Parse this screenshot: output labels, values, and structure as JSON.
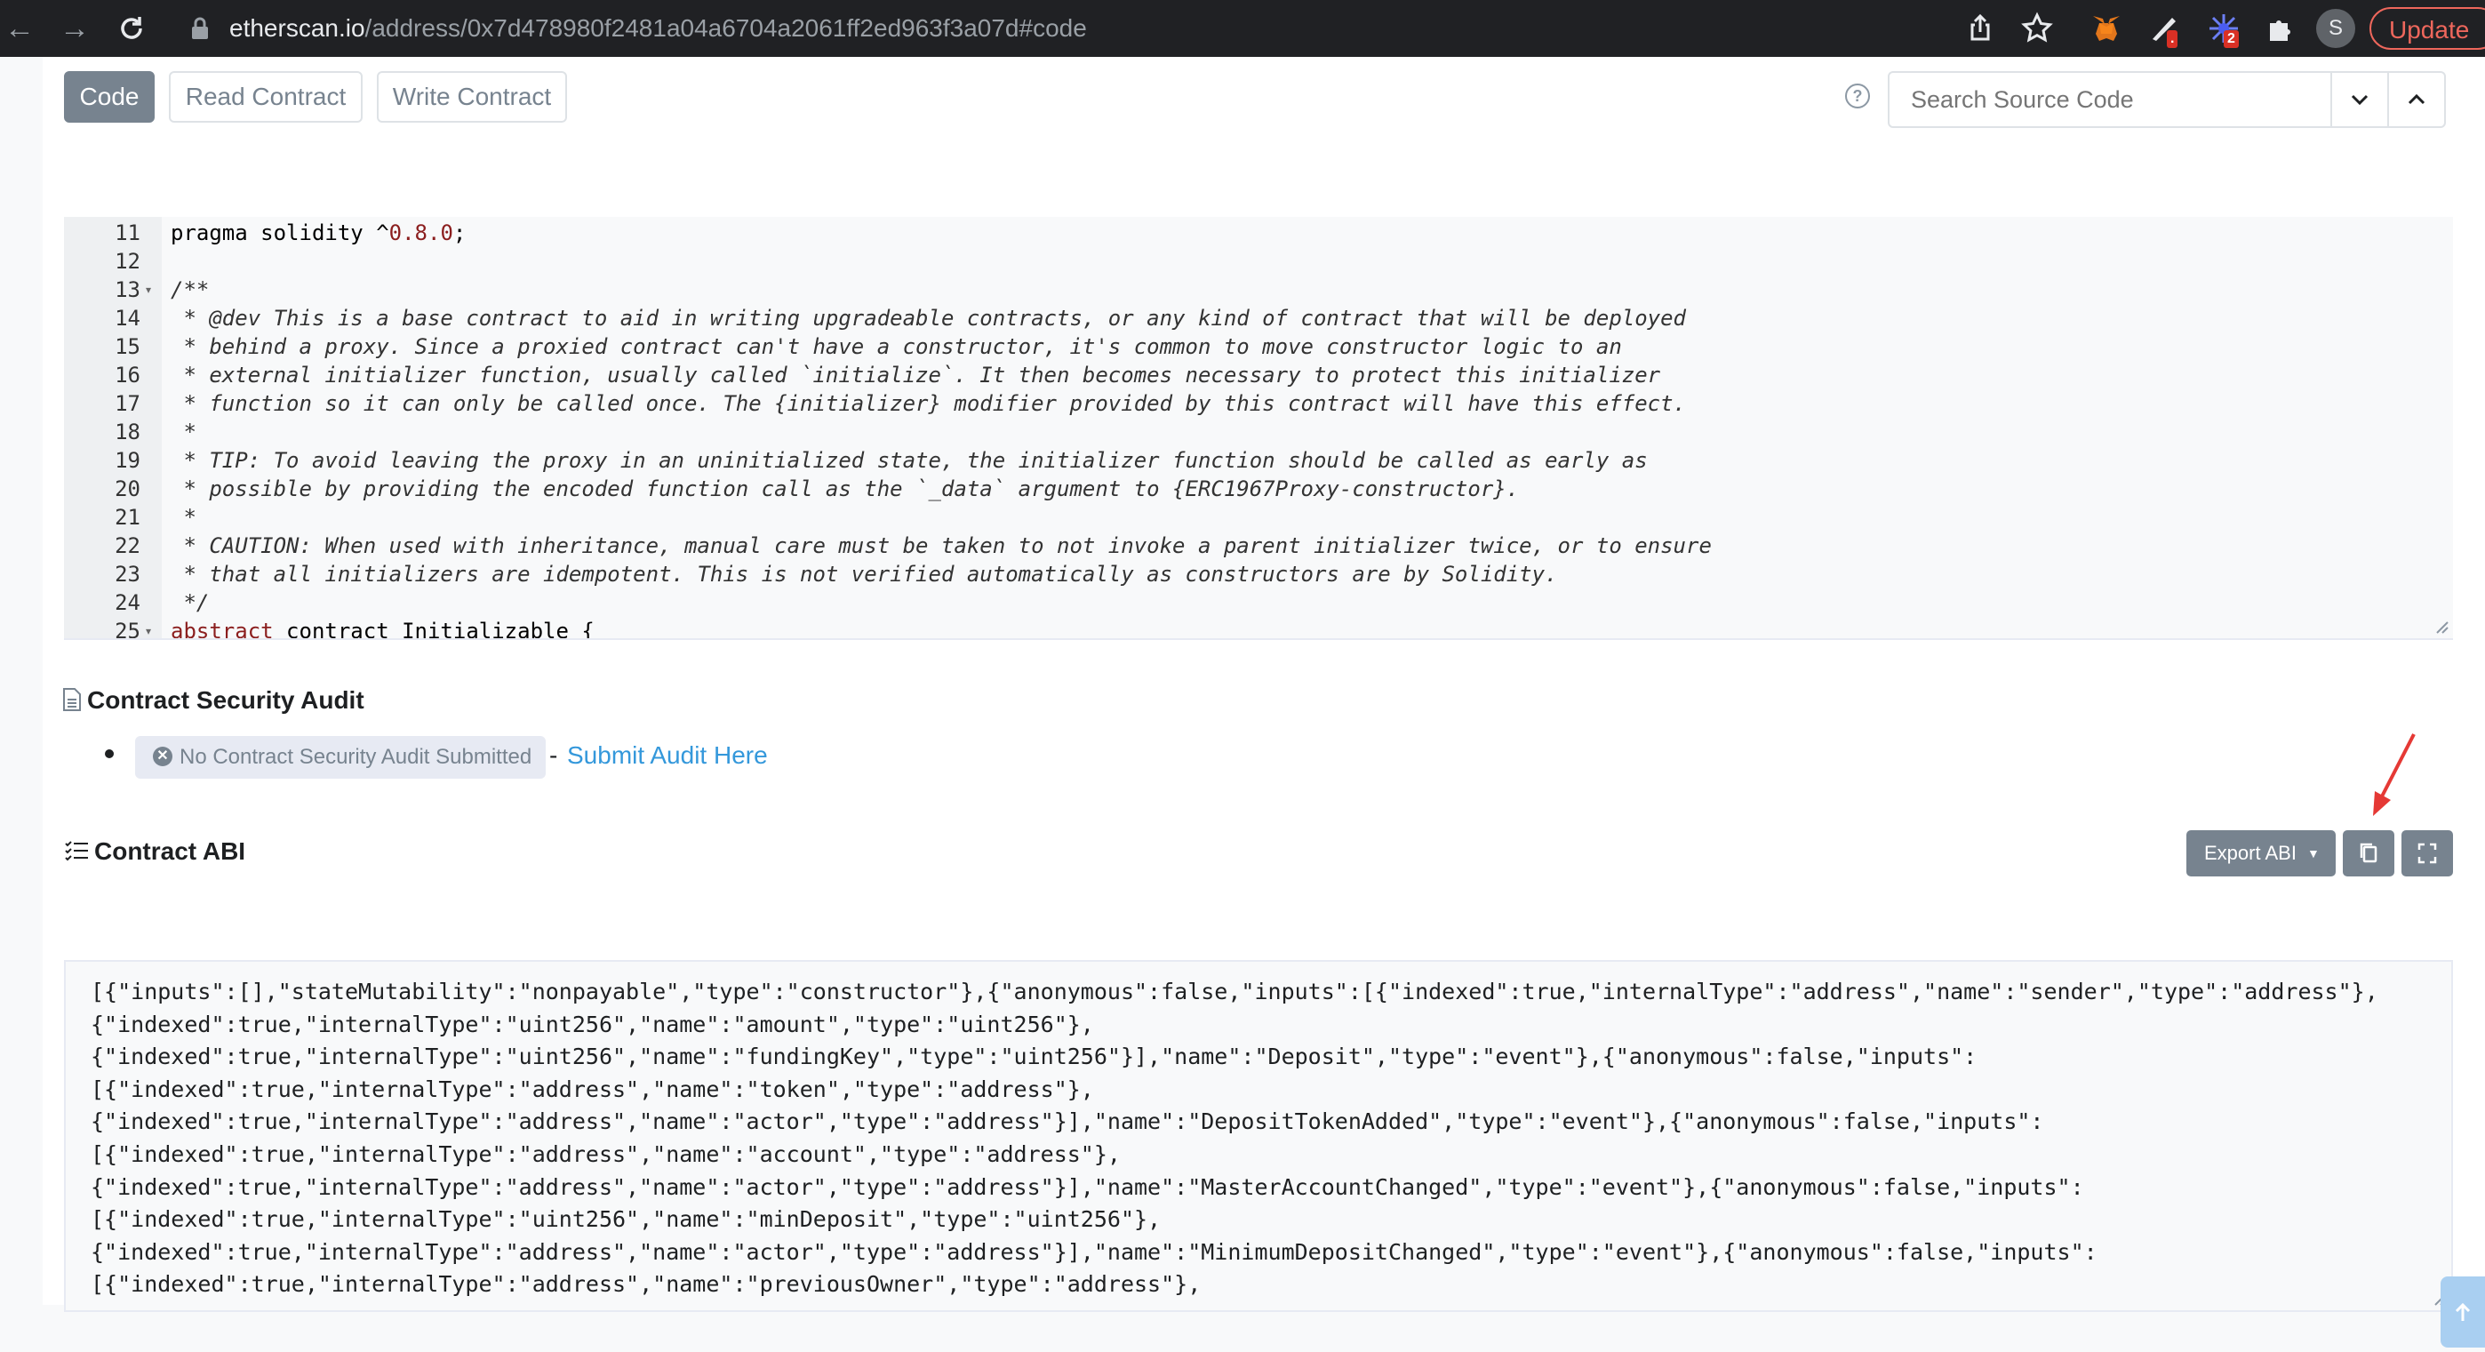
{
  "browser": {
    "url_host": "etherscan.io",
    "url_path": "/address/0x7d478980f2481a04a6704a2061ff2ed963f3a07d#code",
    "extension_badge_1": ".",
    "extension_badge_2": "2",
    "profile_initial": "S",
    "update_label": "Update"
  },
  "tabs": [
    {
      "label": "Code"
    },
    {
      "label": "Read Contract"
    },
    {
      "label": "Write Contract"
    }
  ],
  "search": {
    "placeholder": "Search Source Code"
  },
  "help_symbol": "?",
  "code_lines": [
    {
      "num": "11",
      "text": "pragma solidity ^0.8.0;",
      "fold": false
    },
    {
      "num": "12",
      "text": "",
      "fold": false
    },
    {
      "num": "13",
      "text": "/**",
      "fold": true
    },
    {
      "num": "14",
      "text": " * @dev This is a base contract to aid in writing upgradeable contracts, or any kind of contract that will be deployed",
      "fold": false
    },
    {
      "num": "15",
      "text": " * behind a proxy. Since a proxied contract can't have a constructor, it's common to move constructor logic to an",
      "fold": false
    },
    {
      "num": "16",
      "text": " * external initializer function, usually called `initialize`. It then becomes necessary to protect this initializer",
      "fold": false
    },
    {
      "num": "17",
      "text": " * function so it can only be called once. The {initializer} modifier provided by this contract will have this effect.",
      "fold": false
    },
    {
      "num": "18",
      "text": " *",
      "fold": false
    },
    {
      "num": "19",
      "text": " * TIP: To avoid leaving the proxy in an uninitialized state, the initializer function should be called as early as",
      "fold": false
    },
    {
      "num": "20",
      "text": " * possible by providing the encoded function call as the `_data` argument to {ERC1967Proxy-constructor}.",
      "fold": false
    },
    {
      "num": "21",
      "text": " *",
      "fold": false
    },
    {
      "num": "22",
      "text": " * CAUTION: When used with inheritance, manual care must be taken to not invoke a parent initializer twice, or to ensure",
      "fold": false
    },
    {
      "num": "23",
      "text": " * that all initializers are idempotent. This is not verified automatically as constructors are by Solidity.",
      "fold": false
    },
    {
      "num": "24",
      "text": " */",
      "fold": false
    },
    {
      "num": "25",
      "text": "abstract contract Initializable {",
      "fold": true
    }
  ],
  "audit": {
    "title": "Contract Security Audit",
    "no_audit_label": "No Contract Security Audit Submitted",
    "separator": "-",
    "submit_link": "Submit Audit Here"
  },
  "abi": {
    "title": "Contract ABI",
    "export_label": "Export ABI",
    "lines": [
      "[{\"inputs\":[],\"stateMutability\":\"nonpayable\",\"type\":\"constructor\"},{\"anonymous\":false,\"inputs\":[{\"indexed\":true,\"internalType\":\"address\",\"name\":\"sender\",\"type\":\"address\"},",
      "{\"indexed\":true,\"internalType\":\"uint256\",\"name\":\"amount\",\"type\":\"uint256\"},",
      "{\"indexed\":true,\"internalType\":\"uint256\",\"name\":\"fundingKey\",\"type\":\"uint256\"}],\"name\":\"Deposit\",\"type\":\"event\"},{\"anonymous\":false,\"inputs\":",
      "[{\"indexed\":true,\"internalType\":\"address\",\"name\":\"token\",\"type\":\"address\"},",
      "{\"indexed\":true,\"internalType\":\"address\",\"name\":\"actor\",\"type\":\"address\"}],\"name\":\"DepositTokenAdded\",\"type\":\"event\"},{\"anonymous\":false,\"inputs\":",
      "[{\"indexed\":true,\"internalType\":\"address\",\"name\":\"account\",\"type\":\"address\"},",
      "{\"indexed\":true,\"internalType\":\"address\",\"name\":\"actor\",\"type\":\"address\"}],\"name\":\"MasterAccountChanged\",\"type\":\"event\"},{\"anonymous\":false,\"inputs\":",
      "[{\"indexed\":true,\"internalType\":\"uint256\",\"name\":\"minDeposit\",\"type\":\"uint256\"},",
      "{\"indexed\":true,\"internalType\":\"address\",\"name\":\"actor\",\"type\":\"address\"}],\"name\":\"MinimumDepositChanged\",\"type\":\"event\"},{\"anonymous\":false,\"inputs\":",
      "[{\"indexed\":true,\"internalType\":\"address\",\"name\":\"previousOwner\",\"type\":\"address\"},"
    ]
  },
  "colors": {
    "chrome_bg": "#202124",
    "button_gray": "#77838f",
    "link_blue": "#3498db",
    "annotation_red": "#e53935"
  }
}
